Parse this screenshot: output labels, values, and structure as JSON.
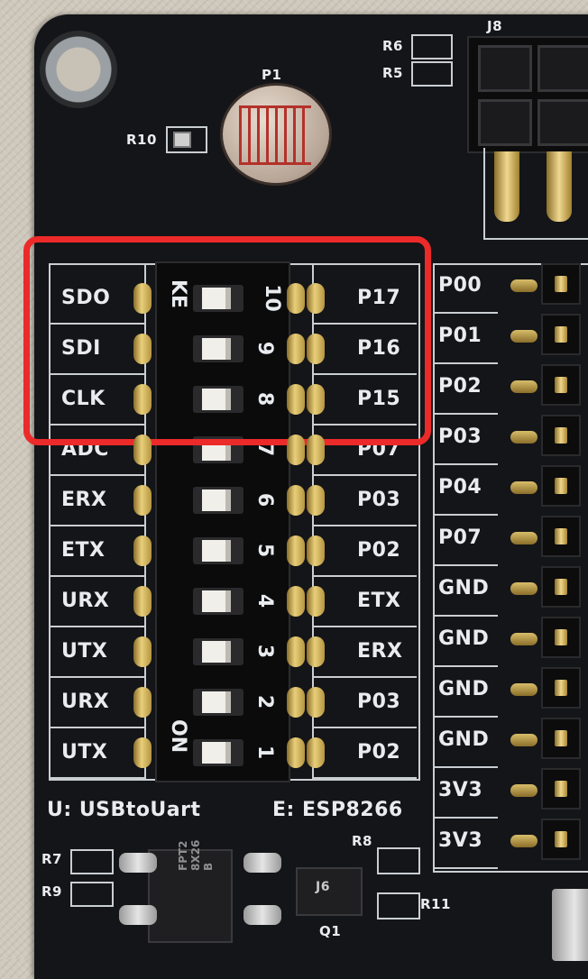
{
  "designators": {
    "j8": "J8",
    "r6": "R6",
    "r5": "R5",
    "p1": "P1",
    "r10": "R10",
    "r7": "R7",
    "r9": "R9",
    "r8": "R8",
    "r11": "R11",
    "q1": "Q1",
    "j6_mark": "J6"
  },
  "left_labels": [
    "SDO",
    "SDI",
    "CLK",
    "ADC",
    "ERX",
    "ETX",
    "URX",
    "UTX",
    "URX",
    "UTX"
  ],
  "right_labels": [
    "P17",
    "P16",
    "P15",
    "P07",
    "P03",
    "P02",
    "ETX",
    "ERX",
    "P03",
    "P02"
  ],
  "dip": {
    "key_label": "KE",
    "on_label": "ON",
    "numbers": [
      "10",
      "9",
      "8",
      "7",
      "6",
      "5",
      "4",
      "3",
      "2",
      "1"
    ]
  },
  "header_labels": [
    "P00",
    "P01",
    "P02",
    "P03",
    "P04",
    "P07",
    "GND",
    "GND",
    "GND",
    "GND",
    "3V3",
    "3V3"
  ],
  "legend": {
    "u": "U: USBtoUart",
    "e": "E: ESP8266"
  },
  "ic_marking": [
    "FPT2",
    "8X26",
    "B"
  ],
  "highlight_color": "#ec2a2a"
}
